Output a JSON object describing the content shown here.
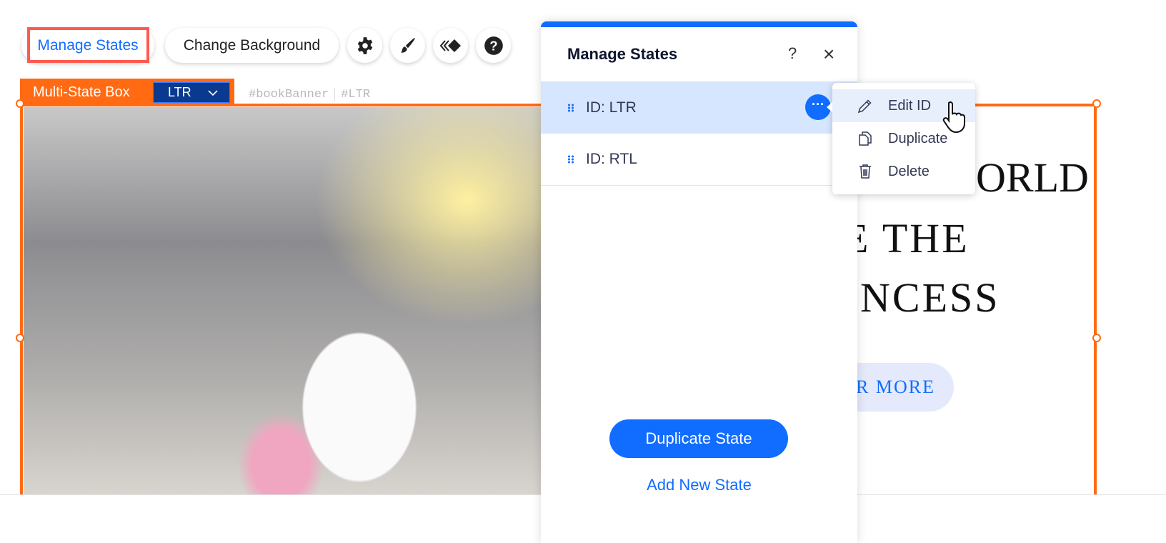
{
  "toolbar": {
    "manage_states": "Manage States",
    "change_background": "Change Background",
    "icons": [
      "gear-icon",
      "paintbrush-icon",
      "animation-icon",
      "help-icon"
    ]
  },
  "element_label": {
    "type": "Multi-State Box",
    "state_dropdown": "LTR",
    "ids": [
      "#bookBanner",
      "#LTR"
    ]
  },
  "canvas": {
    "heading_lines": [
      "ORLD",
      "E THE",
      "RINCESS"
    ],
    "cta": "ER MORE"
  },
  "panel": {
    "title": "Manage States",
    "help": "?",
    "close": "×",
    "states": [
      {
        "label": "ID: LTR",
        "selected": true
      },
      {
        "label": "ID: RTL",
        "selected": false
      }
    ],
    "duplicate_button": "Duplicate State",
    "add_link": "Add New State"
  },
  "context_menu": {
    "items": [
      "Edit ID",
      "Duplicate",
      "Delete"
    ]
  },
  "colors": {
    "accent": "#116dff",
    "selection": "#ff6a13",
    "highlight": "#ff5a50"
  }
}
